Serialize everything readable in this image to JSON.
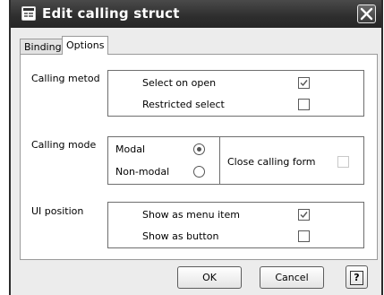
{
  "window": {
    "title": "Edit calling struct",
    "app_icon": "form-icon",
    "close_icon": "close-icon"
  },
  "tabs": [
    {
      "label": "Binding",
      "active": false
    },
    {
      "label": "Options",
      "active": true
    }
  ],
  "calling_method": {
    "label": "Calling metod",
    "options": [
      {
        "label": "Select on open",
        "checked": true
      },
      {
        "label": "Restricted select",
        "checked": false
      }
    ]
  },
  "calling_mode": {
    "label": "Calling mode",
    "options": [
      {
        "label": "Modal",
        "selected": true
      },
      {
        "label": "Non-modal",
        "selected": false
      }
    ],
    "close_form": {
      "label": "Close calling form",
      "checked": false,
      "enabled": false
    }
  },
  "ui_position": {
    "label": "UI position",
    "options": [
      {
        "label": "Show as menu item",
        "checked": true
      },
      {
        "label": "Show as button",
        "checked": false
      }
    ]
  },
  "buttons": {
    "ok": "OK",
    "cancel": "Cancel",
    "help": "?",
    "help_icon": "help-icon"
  }
}
